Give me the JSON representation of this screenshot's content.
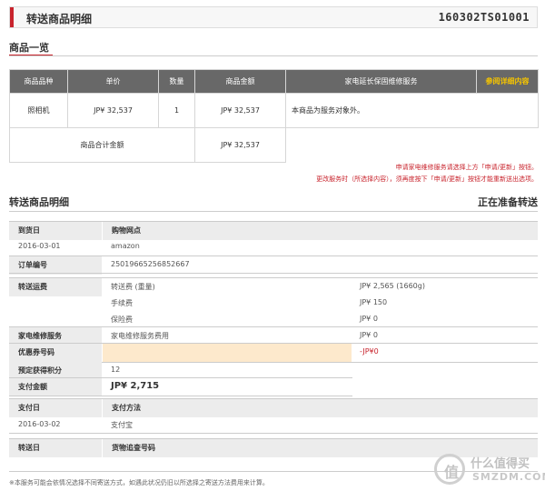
{
  "header": {
    "title": "转送商品明细",
    "order_id": "160302TS01001"
  },
  "products_section": {
    "title": "商品一览",
    "columns": [
      "商品品种",
      "单价",
      "数量",
      "商品金额",
      "家电延长保固维修服务",
      "参阅详细内容"
    ],
    "rows": [
      {
        "category": "照相机",
        "unit_price": "JP¥ 32,537",
        "qty": "1",
        "amount": "JP¥ 32,537",
        "service": "本商品为服务对象外。"
      }
    ],
    "total_label": "商品合计金额",
    "total_value": "JP¥ 32,537"
  },
  "notice": {
    "line1": "申请家电维修服务请选择上方「申请/更新」按钮。",
    "line2": "更改服务时（所选择内容），须再度按下「申请/更新」按钮才能重新送出选项。"
  },
  "detail_section": {
    "title": "转送商品明细",
    "status": "正在准备转送"
  },
  "order_info": {
    "arrival_label": "到货日",
    "arrival_value": "2016-03-01",
    "shop_label": "购物网点",
    "shop_value": "amazon",
    "order_no_label": "订单编号",
    "order_no_value": "25019665256852667"
  },
  "fees": {
    "shipping_label": "转送运费",
    "items": [
      {
        "name": "转送费 (重量)",
        "value": "JP¥ 2,565 (1660g)"
      },
      {
        "name": "手续费",
        "value": "JP¥ 150"
      },
      {
        "name": "保险费",
        "value": "JP¥ 0"
      }
    ],
    "appliance_label": "家电维修服务",
    "appliance_item": "家电维修服务费用",
    "appliance_value": "JP¥ 0",
    "coupon_label": "优惠券号码",
    "coupon_value": "-JP¥0",
    "points_label": "预定获得积分",
    "points_value": "12",
    "total_label": "支付金额",
    "total_value": "JP¥ 2,715"
  },
  "payment": {
    "date_label": "支付日",
    "date_value": "2016-03-02",
    "method_label": "支付方法",
    "method_value": "支付宝"
  },
  "shipping": {
    "date_label": "转送日",
    "tracking_label": "货物追查号码"
  },
  "footnote": "※本服务可能会依情况选择不同寄送方式，如遇此状况仍旧以所选择之寄送方法费用来计算。",
  "watermark": {
    "text": "什么值得买",
    "site": "SMZDM.COM",
    "glyph": "值"
  },
  "colors": {
    "accent": "#c8232c",
    "header_gray": "#686868",
    "link_yellow": "#f5c400",
    "coupon_bg": "#fde9cc"
  }
}
